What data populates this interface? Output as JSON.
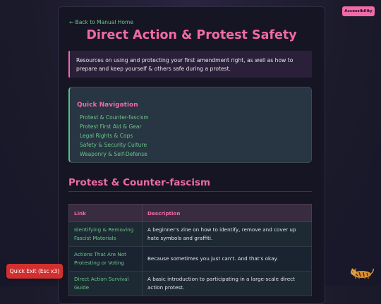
{
  "back_link": "← Back to Manual Home",
  "page_title": "Direct Action & Protest Safety",
  "intro": "Resources on using and protecting your first amendment right, as well as how to prepare and keep yourself & others safe during a protest.",
  "quick_nav": {
    "title": "Quick Navigation",
    "items": [
      "Protest & Counter-fascism",
      "Protest First Aid & Gear",
      "Legal Rights & Cops",
      "Safety & Security Culture",
      "Weaponry & Self-Defense"
    ]
  },
  "section": {
    "heading": "Protest & Counter-fascism",
    "columns": [
      "Link",
      "Description"
    ],
    "rows": [
      {
        "link": "Identifying & Removing Fascist Materials",
        "description": "A beginner's zine on how to identify, remove and cover up hate symbols and graffiti."
      },
      {
        "link": "Actions That Are Not Protesting or Voting",
        "description": "Because sometimes you just can't. And that's okay."
      },
      {
        "link": "Direct Action Survival Guide",
        "description": "A basic introduction to participating in a large-scale direct action protest."
      }
    ]
  },
  "accessibility_button": "Accessibility",
  "quick_exit_button": "Quick Exit (Esc x3)",
  "icons": {
    "mascot": "tiger-icon"
  },
  "colors": {
    "accent": "#f06aa8",
    "link": "#6cc58a",
    "danger": "#d23030"
  }
}
